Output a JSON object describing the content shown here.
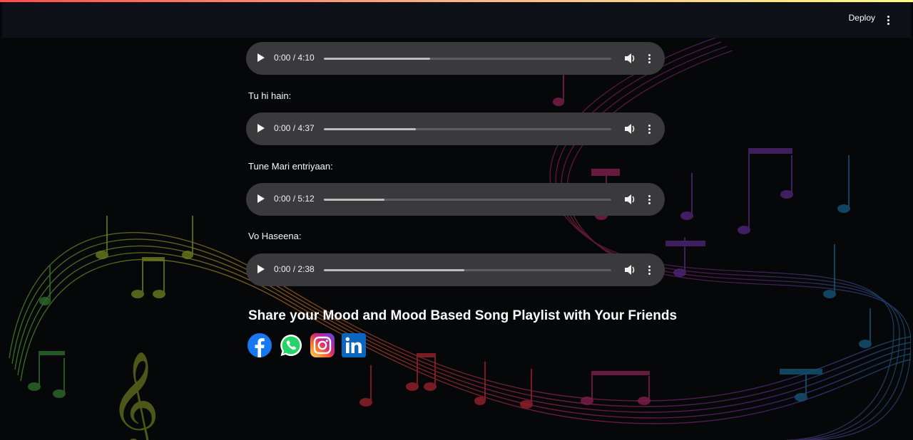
{
  "header": {
    "deploy_label": "Deploy",
    "menu_icon": "kebab-menu-icon"
  },
  "playlist": {
    "first_track": {
      "time": "0:00 / 4:10",
      "progress": 0.37
    },
    "songs": [
      {
        "label": "Tu hi hain:",
        "time": "0:00 / 4:37",
        "progress": 0.32
      },
      {
        "label": "Tune Mari entriyaan:",
        "time": "0:00 / 5:12",
        "progress": 0.21
      },
      {
        "label": "Vo Haseena:",
        "time": "0:00 / 2:38",
        "progress": 0.49
      }
    ]
  },
  "share": {
    "title": "Share your Mood and Mood Based Song Playlist with Your Friends",
    "icons": [
      "facebook-icon",
      "whatsapp-icon",
      "instagram-icon",
      "linkedin-icon"
    ]
  },
  "colors": {
    "header_bg": "#0e1117",
    "page_bg": "#060709",
    "player_bg": "#3a3a3c",
    "facebook": "#1877f2",
    "whatsapp": "#25d366",
    "linkedin": "#0a66c2"
  }
}
